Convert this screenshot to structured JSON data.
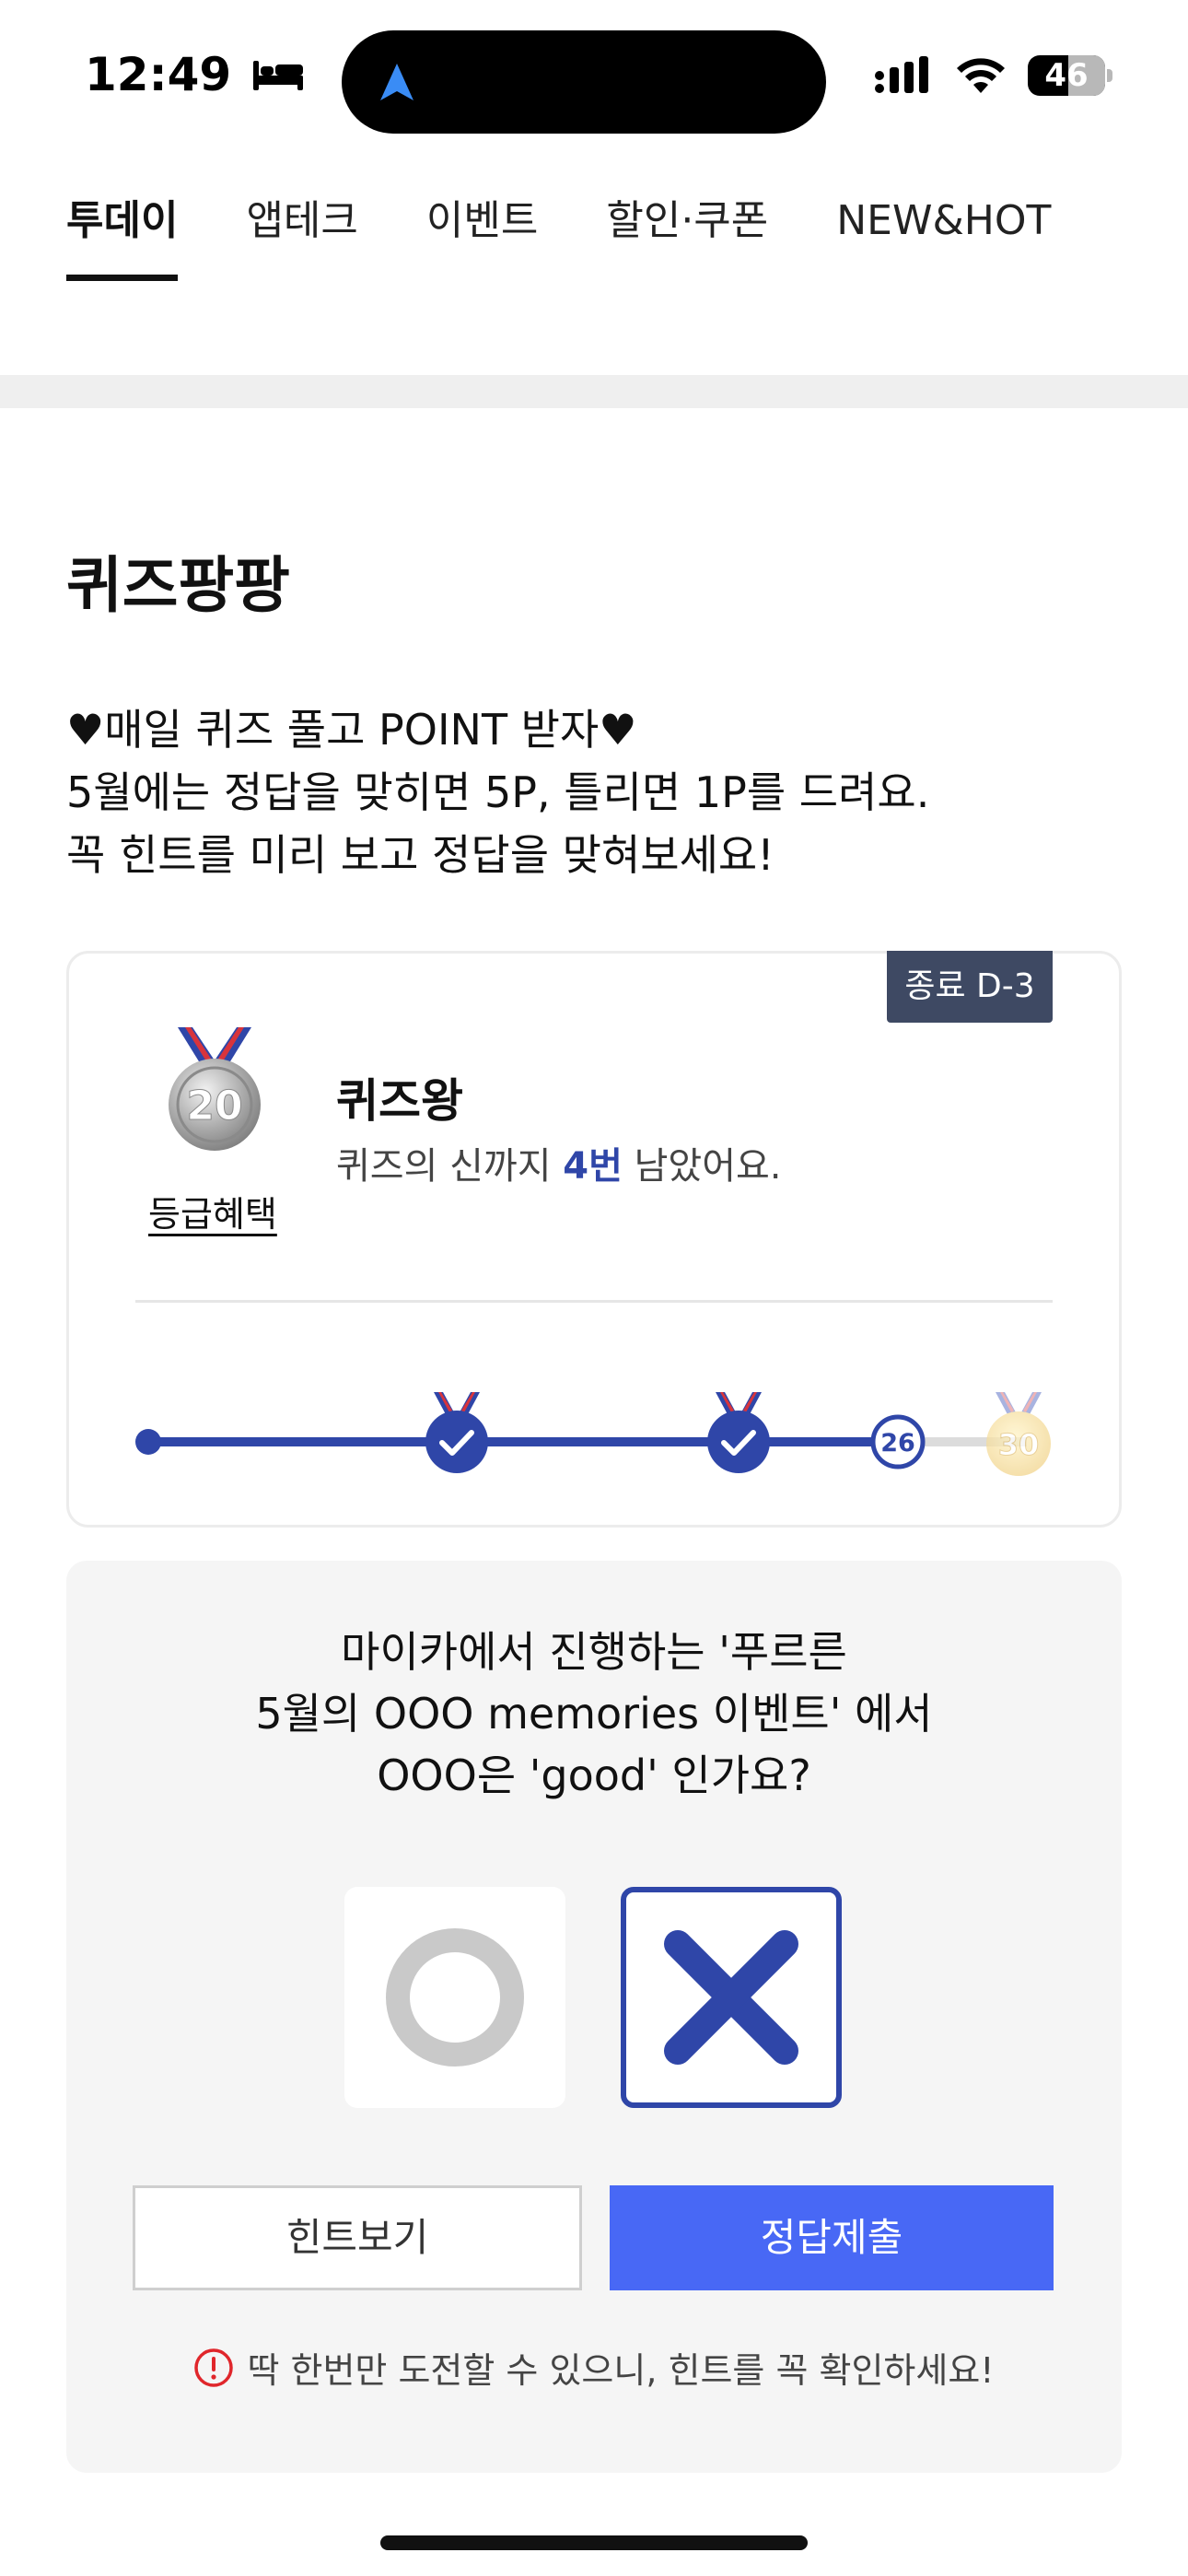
{
  "status_bar": {
    "time": "12:49",
    "battery": "46",
    "icons": [
      "sleep-bed-icon",
      "location-arrow-icon",
      "cellular-signal-icon",
      "wifi-icon",
      "battery-icon"
    ]
  },
  "tabs": [
    {
      "label": "투데이",
      "active": true
    },
    {
      "label": "앱테크",
      "active": false
    },
    {
      "label": "이벤트",
      "active": false
    },
    {
      "label": "할인·쿠폰",
      "active": false
    },
    {
      "label": "NEW&HOT",
      "active": false
    }
  ],
  "page": {
    "title": "퀴즈팡팡",
    "intro": [
      "♥매일 퀴즈 풀고 POINT 받자♥",
      "5월에는 정답을 맞히면 5P, 틀리면 1P를 드려요.",
      "꼭 힌트를 미리 보고 정답을 맞혀보세요!"
    ]
  },
  "rank_card": {
    "dday": "종료 D-3",
    "medal_number": "20",
    "grade_link": "등급혜택",
    "rank_name": "퀴즈왕",
    "desc_prefix": "퀴즈의 신까지 ",
    "desc_accent": "4번",
    "desc_suffix": " 남았어요.",
    "progress": {
      "current": "26",
      "goal": "30",
      "milestones_done": 2
    }
  },
  "quiz": {
    "question_lines": [
      "마이카에서 진행하는 '푸르른",
      "5월의 OOO memories 이벤트' 에서",
      "OOO은 'good' 인가요?"
    ],
    "selected_answer": "X",
    "hint_button": "힌트보기",
    "submit_button": "정답제출",
    "notice": "딱 한번만 도전할 수 있으니, 힌트를 꼭 확인하세요!"
  },
  "colors": {
    "accent": "#2f46a8",
    "submit": "#4868f5",
    "badge": "#3e4963",
    "alert": "#e0262b"
  }
}
